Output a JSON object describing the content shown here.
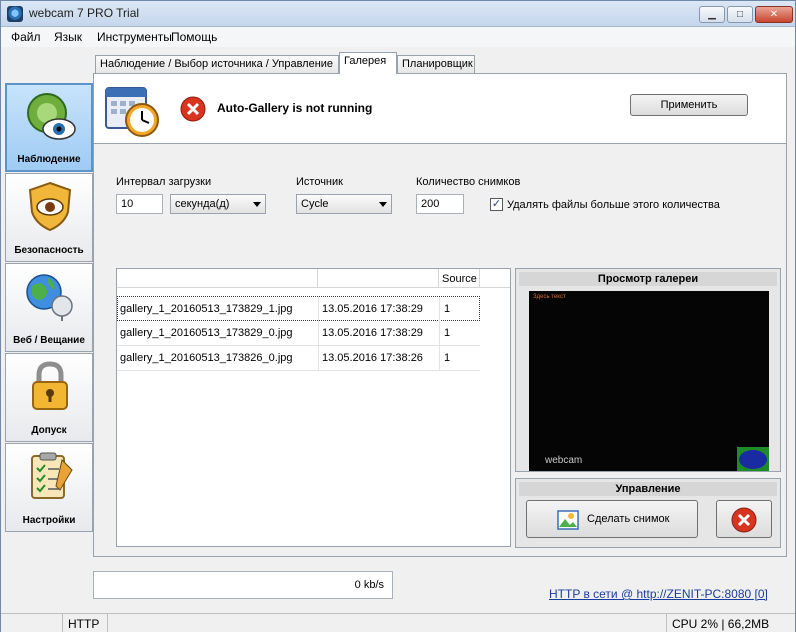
{
  "window": {
    "title": "webcam 7 PRO Trial",
    "controls": {
      "minimize": "▁",
      "maximize": "□",
      "close": "✕"
    }
  },
  "menu": [
    "Файл",
    "Язык",
    "Инструменты",
    "Помощь"
  ],
  "nav": [
    {
      "label": "Наблюдение",
      "icon": "eye-webcam-icon",
      "active": true
    },
    {
      "label": "Безопасность",
      "icon": "shield-eye-icon",
      "active": false
    },
    {
      "label": "Веб / Вещание",
      "icon": "globe-satellite-icon",
      "active": false
    },
    {
      "label": "Допуск",
      "icon": "padlock-icon",
      "active": false
    },
    {
      "label": "Настройки",
      "icon": "clipboard-checklist-icon",
      "active": false
    }
  ],
  "tabs": [
    {
      "label": "Наблюдение / Выбор источника / Управление",
      "active": false
    },
    {
      "label": "Галерея",
      "active": true
    },
    {
      "label": "Планировщик",
      "active": false
    }
  ],
  "gallery": {
    "status_text": "Auto-Gallery is not running",
    "apply_label": "Применить",
    "interval": {
      "label": "Интервал загрузки",
      "value": "10",
      "unit": "секунда(д)"
    },
    "source": {
      "label": "Источник",
      "value": "Cycle"
    },
    "count": {
      "label": "Количество снимков",
      "value": "200"
    },
    "delete_checkbox": {
      "label": "Удалять файлы больше этого количества",
      "checked": true
    },
    "list": {
      "columns": [
        "",
        "",
        "Source"
      ],
      "rows": [
        {
          "file": "gallery_1_20160513_173829_1.jpg",
          "date": "13.05.2016 17:38:29",
          "source": "1",
          "selected": true
        },
        {
          "file": "gallery_1_20160513_173829_0.jpg",
          "date": "13.05.2016 17:38:29",
          "source": "1",
          "selected": false
        },
        {
          "file": "gallery_1_20160513_173826_0.jpg",
          "date": "13.05.2016 17:38:26",
          "source": "1",
          "selected": false
        }
      ]
    },
    "preview": {
      "title": "Просмотр галереи",
      "overlay_text": "Здесь текст",
      "watermark": "webcam"
    },
    "control": {
      "title": "Управление",
      "snapshot_label": "Сделать снимок"
    }
  },
  "bottom": {
    "rate": "0 kb/s",
    "http_link": "HTTP в сети @ http://ZENIT-PC:8080 [0]"
  },
  "statusbar": {
    "left": "",
    "protocol": "HTTP",
    "cpu_mem": "CPU 2% | 66,2MB"
  },
  "colors": {
    "accent": "#3a6fb5",
    "error_red": "#d9341f",
    "link": "#1a3c9c"
  }
}
